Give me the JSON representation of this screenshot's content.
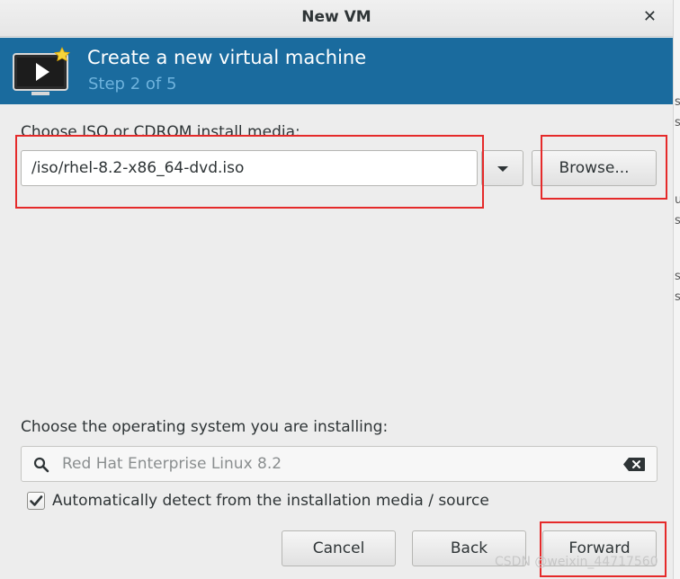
{
  "window": {
    "title": "New VM"
  },
  "banner": {
    "title": "Create a new virtual machine",
    "step": "Step 2 of 5"
  },
  "media": {
    "label": "Choose ISO or CDROM install media:",
    "value": "/iso/rhel-8.2-x86_64-dvd.iso",
    "browse_label": "Browse..."
  },
  "os": {
    "label": "Choose the operating system you are installing:",
    "search_placeholder": "Red Hat Enterprise Linux 8.2",
    "auto_detect_label": "Automatically detect from the installation media / source",
    "auto_detect_checked": true
  },
  "buttons": {
    "cancel": "Cancel",
    "back": "Back",
    "forward": "Forward"
  },
  "side_strip": {
    "letters": [
      "s",
      "s",
      "u",
      "s",
      "s",
      "s"
    ]
  },
  "watermark": "CSDN @weixin_44717560",
  "colors": {
    "banner": "#1a6b9e",
    "step_text": "#6fb3dd",
    "highlight": "#e52a2a"
  }
}
